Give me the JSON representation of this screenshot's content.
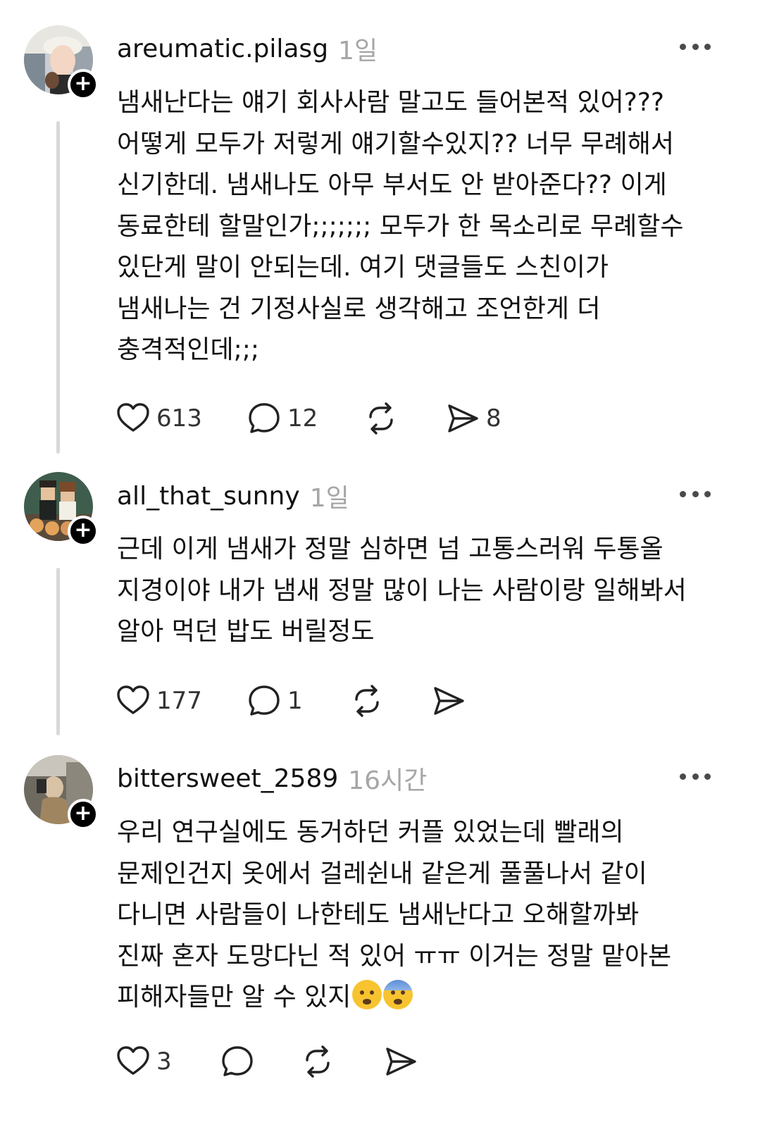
{
  "posts": [
    {
      "username": "areumatic.pilasg",
      "time": "1일",
      "text": "냄새난다는 얘기 회사사람 말고도 들어본적 있어???\n어떻게 모두가 저렇게 얘기할수있지?? 너무 무례해서\n신기한데. 냄새나도 아무 부서도 안 받아준다?? 이게\n동료한테 할말인가;;;;;;; 모두가 한 목소리로 무례할수\n있단게 말이 안되는데. 여기 댓글들도 스친이가\n냄새나는 건 기정사실로 생각해고 조언한게 더\n충격적인데;;;",
      "likes": "613",
      "replies": "12",
      "reposts": "",
      "shares": "8"
    },
    {
      "username": "all_that_sunny",
      "time": "1일",
      "text": "근데 이게 냄새가 정말 심하면 넘 고통스러워 두통올\n지경이야 내가 냄새 정말 많이 나는 사람이랑 일해봐서\n알아 먹던 밥도 버릴정도",
      "likes": "177",
      "replies": "1",
      "reposts": "",
      "shares": ""
    },
    {
      "username": "bittersweet_2589",
      "time": "16시간",
      "text": "우리 연구실에도 동거하던 커플 있었는데 빨래의\n문제인건지 옷에서 걸레쉰내 같은게 풀풀나서 같이\n다니면 사람들이 나한테도 냄새난다고 오해할까봐\n진짜 혼자 도망다닌 적 있어 ㅠㅠ 이거는 정말 맡아본\n피해자들만 알 수 있지",
      "emojis": [
        "😭",
        "😨"
      ],
      "likes": "3",
      "replies": "",
      "reposts": "",
      "shares": ""
    }
  ],
  "icons": {
    "like": "heart-icon",
    "reply": "comment-icon",
    "repost": "repost-icon",
    "share": "share-icon",
    "more": "more-options-icon",
    "follow": "follow-plus-icon"
  },
  "colors": {
    "text": "#111111",
    "muted": "#a6a6a6",
    "thread_line": "#d9d9d9",
    "icon": "#222222"
  }
}
